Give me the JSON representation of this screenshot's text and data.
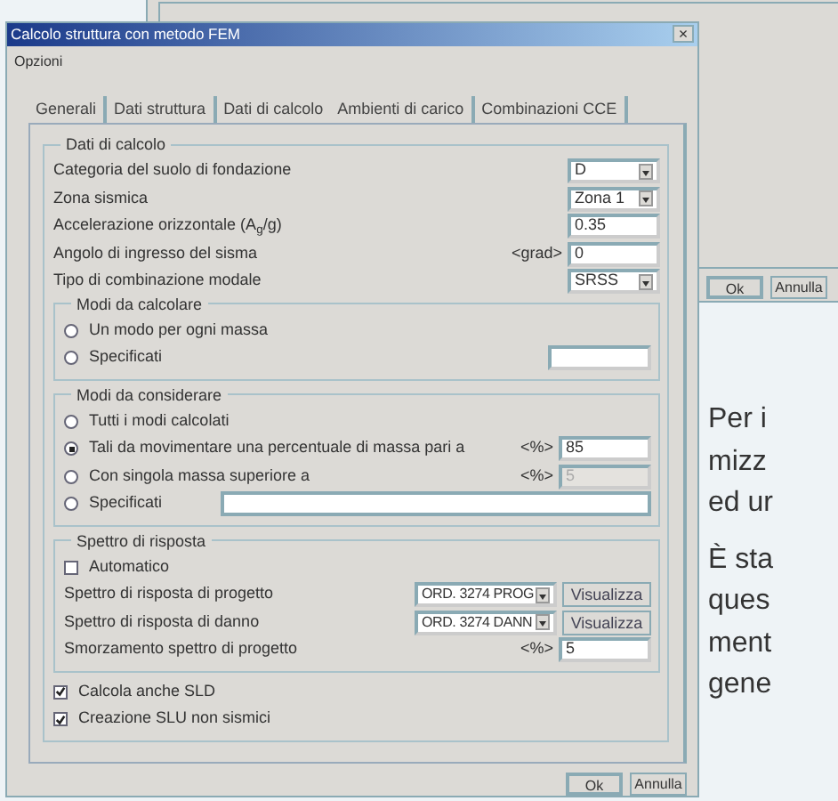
{
  "back_window": {
    "buttons": [
      {
        "label": "Ok",
        "default": true
      },
      {
        "label": "Annulla",
        "default": false
      }
    ]
  },
  "dialog": {
    "title": "Calcolo struttura con metodo FEM",
    "close": "×",
    "menu": [
      "Opzioni"
    ],
    "tabs": [
      {
        "label": "Generali",
        "selected": false
      },
      {
        "label": "Dati struttura",
        "selected": false
      },
      {
        "label": "Dati di calcolo",
        "selected": true
      },
      {
        "label": "Ambienti di carico",
        "selected": false
      },
      {
        "label": "Combinazioni CCE",
        "selected": false
      }
    ],
    "group": {
      "title": "Dati di calcolo",
      "items": [
        {
          "kind": "select",
          "label": "Categoria del suolo di fondazione",
          "value": "D"
        },
        {
          "kind": "select",
          "label": "Zona sismica",
          "value": "Zona 1"
        },
        {
          "kind": "input",
          "label": "Accelerazione orizzontale (A$_{g}$/g)",
          "value": "0.35"
        },
        {
          "kind": "input",
          "label": "Angolo di ingresso del sisma",
          "unit": "<grad>",
          "value": "0"
        },
        {
          "kind": "select",
          "label": "Tipo di combinazione modale",
          "value": "SRSS"
        },
        {
          "kind": "group",
          "title": "Modi da calcolare",
          "items": [
            {
              "kind": "radio",
              "label": "Un modo per ogni massa",
              "selected": false
            },
            {
              "kind": "radio-field",
              "label": "Specificati",
              "selected": false
            }
          ]
        },
        {
          "kind": "group",
          "title": "Modi da considerare",
          "items": [
            {
              "kind": "radio",
              "label": "Tutti i modi calcolati",
              "selected": false
            },
            {
              "kind": "radio",
              "label": "Tali da movimentare una percentuale di massa pari a",
              "selected": true,
              "unit": "<%>",
              "value": "85",
              "disabled": false
            },
            {
              "kind": "radio",
              "label": "Con singola massa superiore a",
              "selected": false,
              "unit": "<%>",
              "value": "5",
              "disabled": true
            },
            {
              "kind": "radio-wide",
              "label": "Specificati",
              "selected": false
            }
          ]
        },
        {
          "kind": "group",
          "title": "Spettro di risposta",
          "items": [
            {
              "kind": "checkbox",
              "label": "Automatico",
              "checked": false
            },
            {
              "kind": "select-button",
              "label": "Spettro di risposta di progetto",
              "value": "ORD. 3274 PROG",
              "button": "Visualizza"
            },
            {
              "kind": "select-button",
              "label": "Spettro di risposta di danno",
              "value": "ORD. 3274 DANN",
              "button": "Visualizza"
            },
            {
              "kind": "input",
              "label": "Smorzamento spettro di progetto",
              "unit": "<%>",
              "value": "5"
            }
          ]
        },
        {
          "kind": "checkbox",
          "label": "Calcola anche SLD",
          "checked": true
        },
        {
          "kind": "checkbox",
          "label": "Creazione SLU non sismici",
          "checked": true
        }
      ]
    },
    "buttons": [
      {
        "label": "Ok",
        "default": true
      },
      {
        "label": "Annulla",
        "default": false
      }
    ]
  },
  "article": {
    "paragraphs": [
      [
        "Per i",
        "mizz",
        "ed ur"
      ],
      [
        "È sta",
        "ques",
        "ment",
        "gene"
      ]
    ]
  }
}
